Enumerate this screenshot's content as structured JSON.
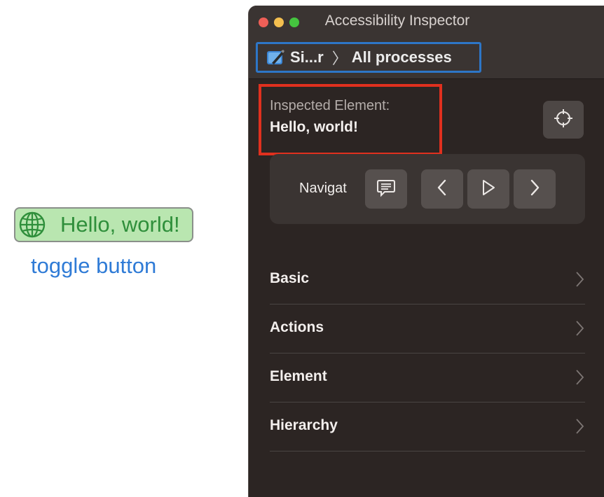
{
  "app": {
    "hello_label": "Hello, world!",
    "toggle_label": "toggle button",
    "hello_icon": "globe-icon"
  },
  "window": {
    "title": "Accessibility Inspector",
    "traffic_lights": [
      "close",
      "minimize",
      "zoom"
    ]
  },
  "pathbar": {
    "app_short": "Si...r",
    "separator": "〉",
    "target": "All processes",
    "app_icon": "xcode-app-icon"
  },
  "inspected": {
    "label": "Inspected Element:",
    "value": "Hello, world!"
  },
  "navigation": {
    "label": "Navigat",
    "buttons": [
      "speech-bubble-icon",
      "chevron-left-icon",
      "play-icon",
      "chevron-right-icon"
    ]
  },
  "sections": [
    {
      "label": "Basic"
    },
    {
      "label": "Actions"
    },
    {
      "label": "Element"
    },
    {
      "label": "Hierarchy"
    }
  ],
  "colors": {
    "highlight_red": "#e0301e",
    "highlight_blue": "#2d76c7",
    "hello_green": "#2f8f3b",
    "link_blue": "#2f7bd6"
  }
}
